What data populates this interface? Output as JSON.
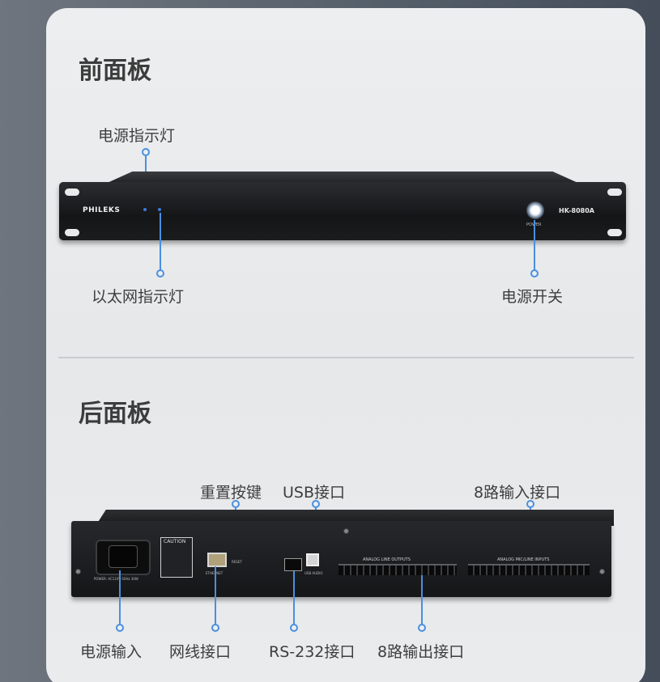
{
  "front_section": {
    "title": "前面板",
    "labels": {
      "power_indicator": "电源指示灯",
      "ethernet_indicator": "以太网指示灯",
      "power_switch": "电源开关"
    },
    "device": {
      "brand": "PHILEKS",
      "model": "HK-8080A",
      "power_text": "POWER"
    }
  },
  "rear_section": {
    "title": "后面板",
    "labels": {
      "reset_button": "重置按键",
      "usb_port": "USB接口",
      "input_8ch": "8路输入接口",
      "power_input": "电源输入",
      "network_port": "网线接口",
      "rs232_port": "RS-232接口",
      "output_8ch": "8路输出接口"
    },
    "device": {
      "caution": "CAUTION",
      "reset_text": "RESET",
      "ethernet_text": "ETHERNET",
      "usb_text": "USB AUDIO",
      "outputs_text": "ANALOG LINE OUTPUTS",
      "inputs_text": "ANALOG MIC/LINE INPUTS",
      "power_spec": "POWER: AC110V-50Hz 30W"
    }
  },
  "colors": {
    "accent": "#4a8fe0",
    "card": "#eceeef",
    "background": "#56606b"
  }
}
